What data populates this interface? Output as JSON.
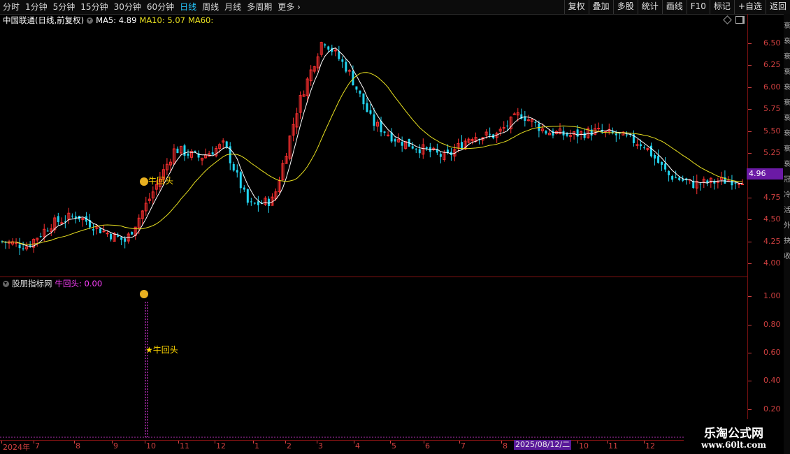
{
  "periods": [
    "分时",
    "1分钟",
    "5分钟",
    "15分钟",
    "30分钟",
    "60分钟",
    "日线",
    "周线",
    "月线",
    "多周期",
    "更多"
  ],
  "active_period": "日线",
  "tools": [
    "复权",
    "叠加",
    "多股",
    "统计",
    "画线",
    "F10",
    "标记",
    "+自选",
    "返回"
  ],
  "main": {
    "stock_name": "中国联通",
    "stock_meta": "(日线,前复权)",
    "ma5_label": "MA5: 4.89",
    "ma10_label": "MA10: 5.07",
    "ma60_label": "MA60:",
    "signal_label": "牛回头",
    "current_price": "4.96"
  },
  "sub": {
    "indicator_name": "股朋指标网",
    "value_label": "牛回头: 0.00",
    "signal_label": "★牛回头"
  },
  "main_yaxis": [
    "6.50",
    "6.25",
    "6.00",
    "5.75",
    "5.50",
    "5.25",
    "4.75",
    "4.50",
    "4.25",
    "4.00"
  ],
  "sub_yaxis": [
    "1.00",
    "0.80",
    "0.60",
    "0.40",
    "0.20"
  ],
  "date_labels": [
    "2024年",
    "7",
    "8",
    "9",
    "10",
    "11",
    "12",
    "1",
    "2",
    "3",
    "4",
    "5",
    "6",
    "7",
    "8",
    "9",
    "10",
    "11",
    "12"
  ],
  "selected_date": "2025/08/12/二",
  "side_chars": [
    "衰",
    "衰",
    "衰",
    "衰",
    "衰",
    "衰",
    "衰",
    "衰",
    "衰",
    "衰",
    "冠",
    "冷",
    "活",
    "外",
    "抉",
    "收"
  ],
  "watermark": {
    "title": "乐淘公式网",
    "url": "www.60lt.com"
  },
  "colors": {
    "up": "#ff3030",
    "down": "#22d4f0",
    "ma5": "#ffffff",
    "ma10": "#e8e020",
    "accent": "#6b1aa5",
    "signal": "#ff40ff"
  },
  "chart_data": {
    "type": "candlestick",
    "y_range": [
      3.9,
      6.75
    ],
    "sub_y_range": [
      0,
      1.1
    ],
    "signal_value": 1.0,
    "signal_text_value": 0.6,
    "key_prices": [
      4.25,
      4.2,
      4.45,
      4.55,
      4.38,
      4.25,
      4.75,
      5.3,
      5.2,
      5.35,
      4.65,
      4.72,
      5.8,
      6.55,
      6.2,
      5.6,
      5.4,
      5.3,
      5.2,
      5.45,
      5.45,
      5.7,
      5.5,
      5.45,
      5.5,
      5.45,
      5.35,
      5.0,
      4.9,
      4.93,
      4.96
    ]
  }
}
